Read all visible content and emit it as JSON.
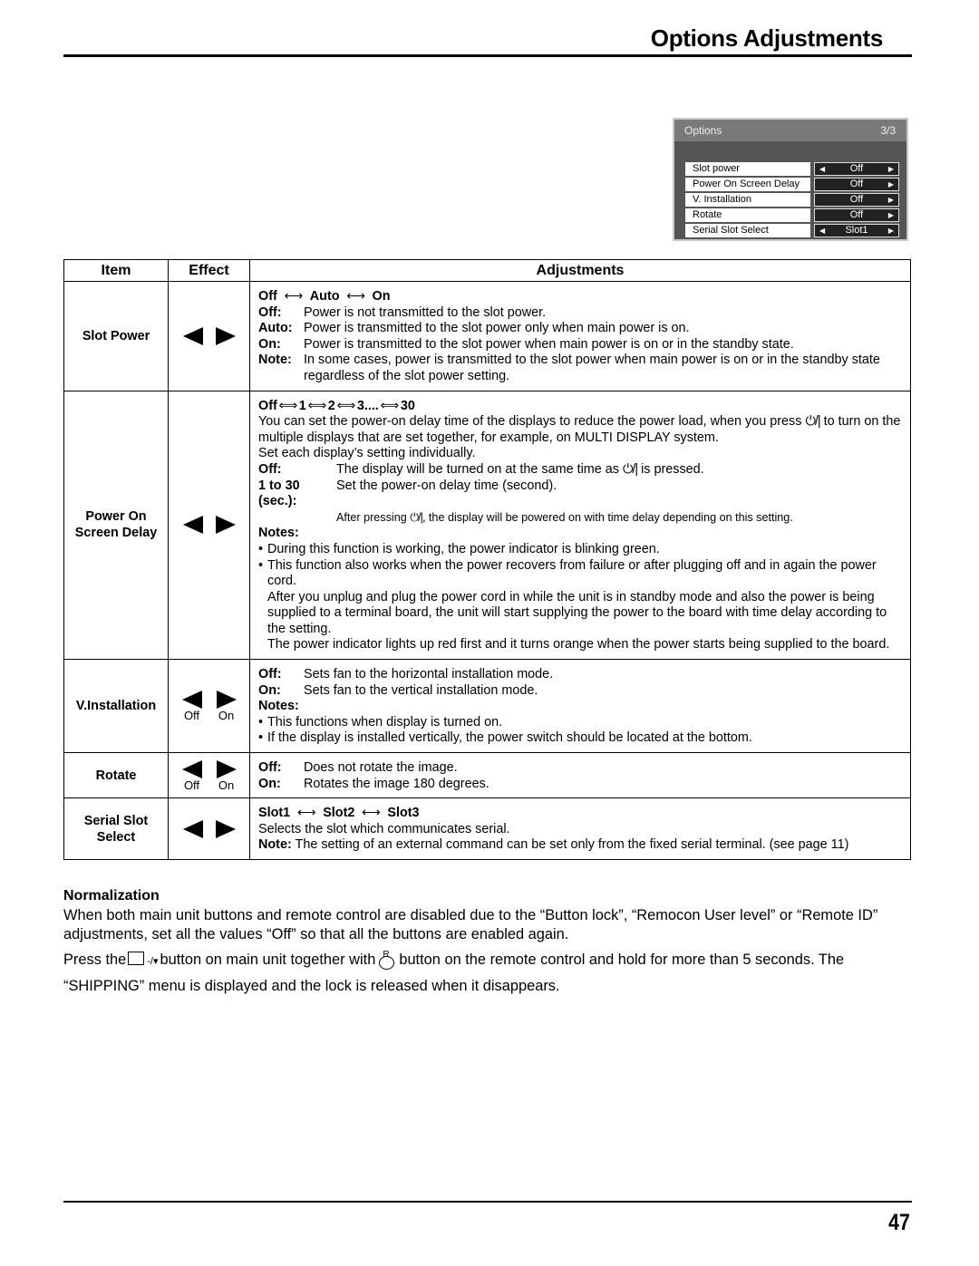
{
  "header": {
    "title": "Options Adjustments"
  },
  "osd_menu": {
    "title": "Options",
    "page": "3/3",
    "rows": [
      {
        "label": "Slot power",
        "value": "Off",
        "left_arrow": true,
        "right_arrow": true
      },
      {
        "label": "Power On Screen Delay",
        "value": "Off",
        "left_arrow": false,
        "right_arrow": true
      },
      {
        "label": "V. Installation",
        "value": "Off",
        "left_arrow": false,
        "right_arrow": true
      },
      {
        "label": "Rotate",
        "value": "Off",
        "left_arrow": false,
        "right_arrow": true
      },
      {
        "label": "Serial Slot Select",
        "value": "Slot1",
        "left_arrow": true,
        "right_arrow": true
      }
    ]
  },
  "table": {
    "headers": {
      "item": "Item",
      "effect": "Effect",
      "adjustments": "Adjustments"
    },
    "slot_power": {
      "item": "Slot Power",
      "cycle": [
        "Off",
        "Auto",
        "On"
      ],
      "lines": [
        {
          "key": "Off:",
          "text": "Power is not transmitted to the slot power."
        },
        {
          "key": "Auto:",
          "text": "Power is transmitted to the slot power only when main power is on."
        },
        {
          "key": "On:",
          "text": "Power is transmitted to the slot power when main power is on or in the standby state."
        },
        {
          "key": "Note:",
          "text": "In some cases, power is transmitted to the slot power when main power is on or in the standby state regardless of the slot power setting."
        }
      ]
    },
    "power_on_delay": {
      "item_line1": "Power On",
      "item_line2": "Screen Delay",
      "cycle": [
        "Off",
        "1",
        "2",
        "3....",
        "30"
      ],
      "intro_a": "You can set the power-on delay time of the displays to reduce the power load, when you press",
      "intro_b": "to turn on the multiple displays that are set together, for example, on MULTI DISPLAY system.",
      "intro_c": "Set each display’s setting individually.",
      "off_key": "Off:",
      "off_text_a": "The display will be turned on at the same time as",
      "off_text_b": "is pressed.",
      "range_key": "1 to 30 (sec.):",
      "range_text": "Set the power-on delay time (second).",
      "after_a": "After pressing",
      "after_b": ", the display will be powered on with time delay depending on this setting.",
      "notes_label": "Notes:",
      "note1": "During this function is working, the power indicator is blinking green.",
      "note2": "This function also works when the power recovers from failure or after plugging off and in again the power cord.",
      "note2b": "After you unplug and plug the power cord in while the unit is in standby mode and also the power is being supplied to a terminal board, the unit will start supplying the power to the board with time delay according to the setting.",
      "note2c": "The power indicator lights up red first and it turns orange when the power starts being supplied to the board.",
      "power_symbol": "⏻/|"
    },
    "v_installation": {
      "item": "V.Installation",
      "effect_left": "Off",
      "effect_right": "On",
      "off_key": "Off:",
      "off_text": "Sets fan to the horizontal installation mode.",
      "on_key": "On:",
      "on_text": "Sets fan to the vertical installation mode.",
      "notes_label": "Notes:",
      "note1": "This functions when display is turned on.",
      "note2": "If the display is installed vertically, the power switch should be located at the bottom."
    },
    "rotate": {
      "item": "Rotate",
      "effect_left": "Off",
      "effect_right": "On",
      "off_key": "Off:",
      "off_text": "Does not rotate the image.",
      "on_key": "On:",
      "on_text": "Rotates the image 180 degrees."
    },
    "serial_slot": {
      "item_line1": "Serial Slot",
      "item_line2": "Select",
      "cycle": [
        "Slot1",
        "Slot2",
        "Slot3"
      ],
      "desc": "Selects the slot which communicates serial.",
      "note_key": "Note:",
      "note_text": "The setting of an external command can be set only from the fixed serial terminal. (see page 11)"
    }
  },
  "normalization": {
    "title": "Normalization",
    "para1": "When both main unit buttons and remote control are disabled due to the “Button lock”, “Remocon User level” or “Remote ID” adjustments, set all the values “Off” so that all the buttons are enabled again.",
    "para2_a": "Press the",
    "para2_btn": "-/▾",
    "para2_b": "button on main unit together with",
    "para2_r": "R",
    "para2_c": "button on the remote control and hold for more than 5 seconds. The “SHIPPING” menu is displayed and the lock is released when it disappears."
  },
  "footer": {
    "page_number": "47"
  }
}
